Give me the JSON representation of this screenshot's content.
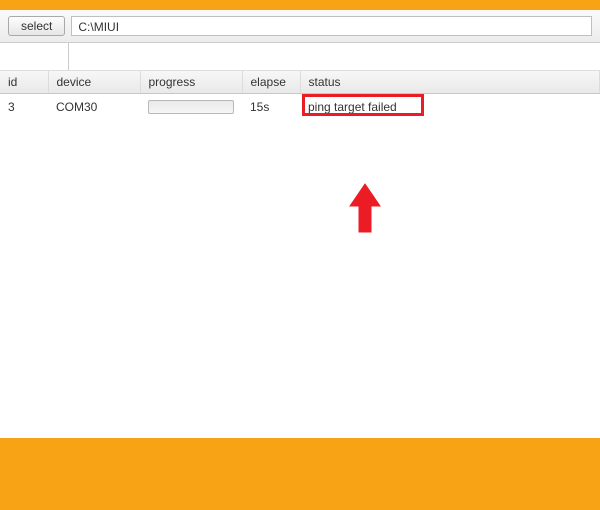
{
  "toolbar": {
    "select_label": "select",
    "path": "C:\\MIUI"
  },
  "table": {
    "headers": {
      "id": "id",
      "device": "device",
      "progress": "progress",
      "elapse": "elapse",
      "status": "status"
    },
    "rows": [
      {
        "id": "3",
        "device": "COM30",
        "elapse": "15s",
        "status": "ping target failed"
      }
    ]
  },
  "annotation": {
    "highlight_color": "#ec1c24"
  }
}
